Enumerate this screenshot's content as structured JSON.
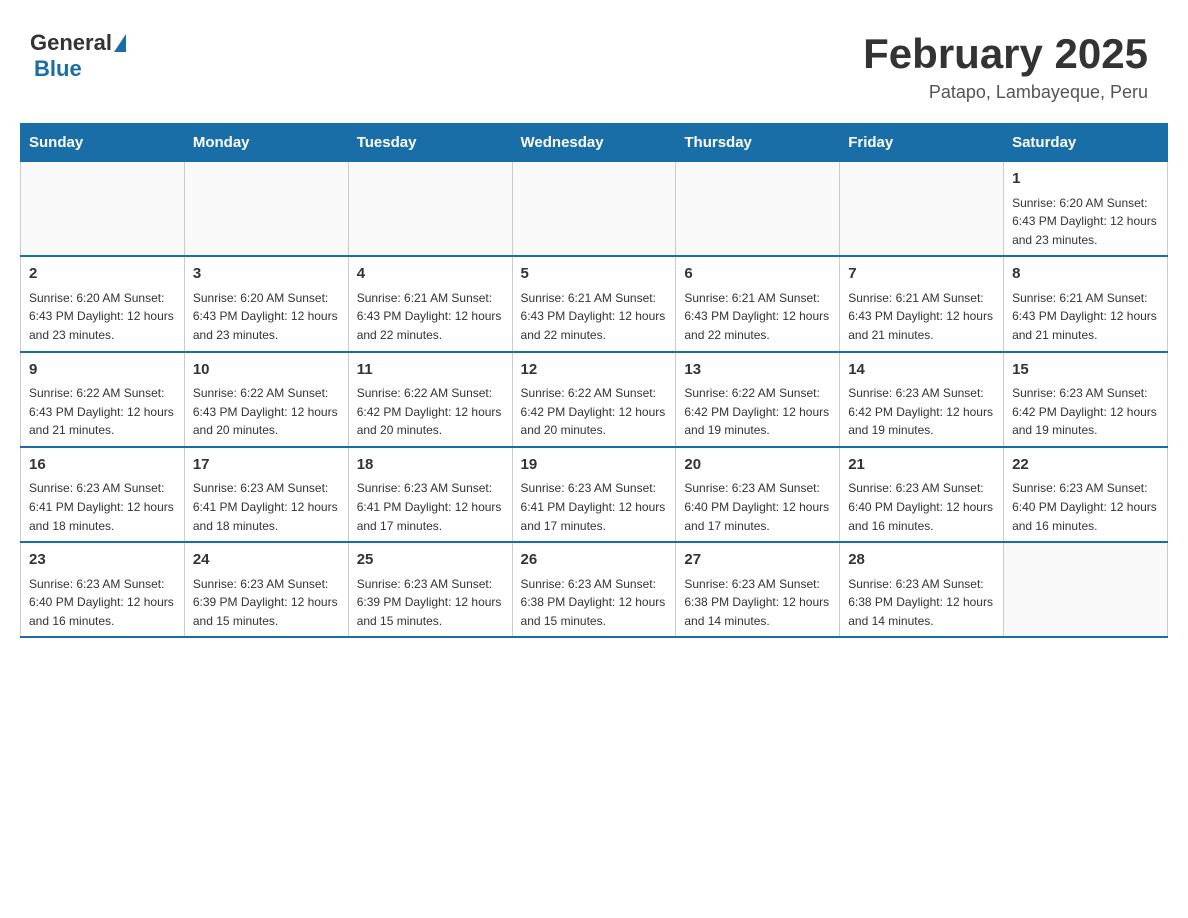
{
  "header": {
    "logo_general": "General",
    "logo_blue": "Blue",
    "title": "February 2025",
    "subtitle": "Patapo, Lambayeque, Peru"
  },
  "weekdays": [
    "Sunday",
    "Monday",
    "Tuesday",
    "Wednesday",
    "Thursday",
    "Friday",
    "Saturday"
  ],
  "weeks": [
    [
      {
        "day": "",
        "info": ""
      },
      {
        "day": "",
        "info": ""
      },
      {
        "day": "",
        "info": ""
      },
      {
        "day": "",
        "info": ""
      },
      {
        "day": "",
        "info": ""
      },
      {
        "day": "",
        "info": ""
      },
      {
        "day": "1",
        "info": "Sunrise: 6:20 AM\nSunset: 6:43 PM\nDaylight: 12 hours and 23 minutes."
      }
    ],
    [
      {
        "day": "2",
        "info": "Sunrise: 6:20 AM\nSunset: 6:43 PM\nDaylight: 12 hours and 23 minutes."
      },
      {
        "day": "3",
        "info": "Sunrise: 6:20 AM\nSunset: 6:43 PM\nDaylight: 12 hours and 23 minutes."
      },
      {
        "day": "4",
        "info": "Sunrise: 6:21 AM\nSunset: 6:43 PM\nDaylight: 12 hours and 22 minutes."
      },
      {
        "day": "5",
        "info": "Sunrise: 6:21 AM\nSunset: 6:43 PM\nDaylight: 12 hours and 22 minutes."
      },
      {
        "day": "6",
        "info": "Sunrise: 6:21 AM\nSunset: 6:43 PM\nDaylight: 12 hours and 22 minutes."
      },
      {
        "day": "7",
        "info": "Sunrise: 6:21 AM\nSunset: 6:43 PM\nDaylight: 12 hours and 21 minutes."
      },
      {
        "day": "8",
        "info": "Sunrise: 6:21 AM\nSunset: 6:43 PM\nDaylight: 12 hours and 21 minutes."
      }
    ],
    [
      {
        "day": "9",
        "info": "Sunrise: 6:22 AM\nSunset: 6:43 PM\nDaylight: 12 hours and 21 minutes."
      },
      {
        "day": "10",
        "info": "Sunrise: 6:22 AM\nSunset: 6:43 PM\nDaylight: 12 hours and 20 minutes."
      },
      {
        "day": "11",
        "info": "Sunrise: 6:22 AM\nSunset: 6:42 PM\nDaylight: 12 hours and 20 minutes."
      },
      {
        "day": "12",
        "info": "Sunrise: 6:22 AM\nSunset: 6:42 PM\nDaylight: 12 hours and 20 minutes."
      },
      {
        "day": "13",
        "info": "Sunrise: 6:22 AM\nSunset: 6:42 PM\nDaylight: 12 hours and 19 minutes."
      },
      {
        "day": "14",
        "info": "Sunrise: 6:23 AM\nSunset: 6:42 PM\nDaylight: 12 hours and 19 minutes."
      },
      {
        "day": "15",
        "info": "Sunrise: 6:23 AM\nSunset: 6:42 PM\nDaylight: 12 hours and 19 minutes."
      }
    ],
    [
      {
        "day": "16",
        "info": "Sunrise: 6:23 AM\nSunset: 6:41 PM\nDaylight: 12 hours and 18 minutes."
      },
      {
        "day": "17",
        "info": "Sunrise: 6:23 AM\nSunset: 6:41 PM\nDaylight: 12 hours and 18 minutes."
      },
      {
        "day": "18",
        "info": "Sunrise: 6:23 AM\nSunset: 6:41 PM\nDaylight: 12 hours and 17 minutes."
      },
      {
        "day": "19",
        "info": "Sunrise: 6:23 AM\nSunset: 6:41 PM\nDaylight: 12 hours and 17 minutes."
      },
      {
        "day": "20",
        "info": "Sunrise: 6:23 AM\nSunset: 6:40 PM\nDaylight: 12 hours and 17 minutes."
      },
      {
        "day": "21",
        "info": "Sunrise: 6:23 AM\nSunset: 6:40 PM\nDaylight: 12 hours and 16 minutes."
      },
      {
        "day": "22",
        "info": "Sunrise: 6:23 AM\nSunset: 6:40 PM\nDaylight: 12 hours and 16 minutes."
      }
    ],
    [
      {
        "day": "23",
        "info": "Sunrise: 6:23 AM\nSunset: 6:40 PM\nDaylight: 12 hours and 16 minutes."
      },
      {
        "day": "24",
        "info": "Sunrise: 6:23 AM\nSunset: 6:39 PM\nDaylight: 12 hours and 15 minutes."
      },
      {
        "day": "25",
        "info": "Sunrise: 6:23 AM\nSunset: 6:39 PM\nDaylight: 12 hours and 15 minutes."
      },
      {
        "day": "26",
        "info": "Sunrise: 6:23 AM\nSunset: 6:38 PM\nDaylight: 12 hours and 15 minutes."
      },
      {
        "day": "27",
        "info": "Sunrise: 6:23 AM\nSunset: 6:38 PM\nDaylight: 12 hours and 14 minutes."
      },
      {
        "day": "28",
        "info": "Sunrise: 6:23 AM\nSunset: 6:38 PM\nDaylight: 12 hours and 14 minutes."
      },
      {
        "day": "",
        "info": ""
      }
    ]
  ]
}
